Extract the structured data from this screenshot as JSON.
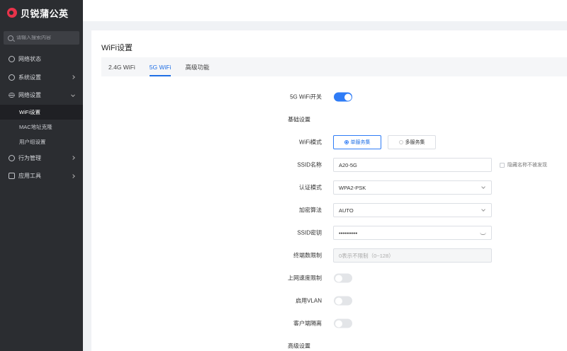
{
  "brand": {
    "name": "贝锐蒲公英"
  },
  "search": {
    "placeholder": "请输入搜索内容"
  },
  "sidebar": {
    "items": [
      {
        "label": "网络状态",
        "icon": "globe-icon"
      },
      {
        "label": "系统设置",
        "icon": "gear-icon"
      },
      {
        "label": "网络设置",
        "icon": "list-icon",
        "children": [
          {
            "label": "WiFi设置",
            "active": true
          },
          {
            "label": "MAC地址克隆",
            "active": false
          },
          {
            "label": "用户组设置",
            "active": false
          }
        ]
      },
      {
        "label": "行为管理",
        "icon": "behavior-icon"
      },
      {
        "label": "应用工具",
        "icon": "tools-icon"
      }
    ]
  },
  "page": {
    "title": "WiFi设置"
  },
  "tabs": [
    {
      "label": "2.4G WiFi",
      "active": false
    },
    {
      "label": "5G WiFi",
      "active": true
    },
    {
      "label": "高级功能",
      "active": false
    }
  ],
  "form": {
    "wifi_switch": {
      "label": "5G WiFi开关",
      "on": true
    },
    "basic_section": "基础设置",
    "wifi_mode": {
      "label": "WiFi模式",
      "options": [
        "单服务集",
        "多服务集"
      ],
      "selected": "单服务集"
    },
    "ssid": {
      "label": "SSID名称",
      "value": "A20-5G",
      "hide_label": "隐藏名称不被发现",
      "hidden": false
    },
    "auth_mode": {
      "label": "认证模式",
      "value": "WPA2-PSK"
    },
    "encryption": {
      "label": "加密算法",
      "value": "AUTO"
    },
    "password": {
      "label": "SSID密钥",
      "value": "••••••••••"
    },
    "max_clients": {
      "label": "终端数限制",
      "placeholder": "0表示不限制（0~128）"
    },
    "rate_limit": {
      "label": "上网速度限制",
      "on": false
    },
    "vlan": {
      "label": "启用VLAN",
      "on": false
    },
    "isolation": {
      "label": "客户端隔离",
      "on": false
    },
    "advanced_section": "高级设置"
  },
  "colors": {
    "accent": "#2f7cf6",
    "sidebar_bg": "#2b2d31",
    "brand": "#e8334a"
  }
}
